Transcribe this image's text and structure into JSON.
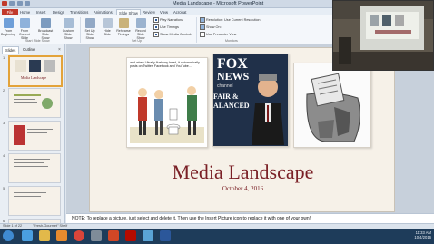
{
  "window": {
    "title": "Media Landscape - Microsoft PowerPoint"
  },
  "tabs": [
    "File",
    "Home",
    "Insert",
    "Design",
    "Transitions",
    "Animations",
    "Slide Show",
    "Review",
    "View",
    "Acrobat"
  ],
  "ribbon": {
    "buttons": [
      {
        "label": "From Beginning",
        "icon": "play-icon"
      },
      {
        "label": "From Current Slide",
        "icon": "play-current-icon"
      },
      {
        "label": "Broadcast Slide Show",
        "icon": "broadcast-icon"
      },
      {
        "label": "Custom Slide Show",
        "icon": "custom-show-icon"
      },
      {
        "label": "Set Up Slide Show",
        "icon": "setup-icon"
      },
      {
        "label": "Hide Slide",
        "icon": "hide-slide-icon"
      },
      {
        "label": "Rehearse Timings",
        "icon": "rehearse-icon"
      },
      {
        "label": "Record Slide Show",
        "icon": "record-icon"
      }
    ],
    "checks": [
      {
        "label": "Play Narrations",
        "checked": true
      },
      {
        "label": "Use Timings",
        "checked": true
      },
      {
        "label": "Show Media Controls",
        "checked": true
      }
    ],
    "resolution_label": "Resolution: Use Current Resolution",
    "show_on_label": "Show On:",
    "presenter_view_label": "Use Presenter View",
    "groups": [
      "Start Slide Show",
      "Set Up",
      "Monitors"
    ]
  },
  "pane": {
    "tabs": [
      "Slides",
      "Outline"
    ],
    "thumbs": [
      "1",
      "2",
      "3",
      "4",
      "5",
      "6"
    ],
    "thumb1_title": "Media Landscape"
  },
  "slide": {
    "title": "Media Landscape",
    "date": "October 4, 2016",
    "cartoon_caption": "and when I finally flush my head, it automatically posts on Twitter, Facebook and YouTube…",
    "fox_logo_top": "FOX",
    "fox_logo_bottom": "NEWS",
    "fox_channel": "channel",
    "fox_tagline_1": "FAIR &",
    "fox_tagline_2": "ALANCED"
  },
  "notes": {
    "text": "NOTE: To replace a picture, just select and delete it. Then use the Insert Picture icon to replace it with one of your own!"
  },
  "status": {
    "slide_info": "Slide 1 of 22",
    "theme": "\"Fresh-Gourmet\" Shelf"
  },
  "taskbar": {
    "time": "11:33 AM",
    "date": "10/4/2016",
    "icons": [
      "start-orb-icon",
      "ie-icon",
      "explorer-icon",
      "media-player-icon",
      "chrome-icon",
      "powerpoint-icon",
      "acrobat-icon",
      "paint-icon",
      "word-icon",
      "misc-icon"
    ]
  },
  "colors": {
    "accent_red": "#7a2026",
    "file_tab": "#c1392b",
    "taskbar": "#1e3c5a"
  }
}
